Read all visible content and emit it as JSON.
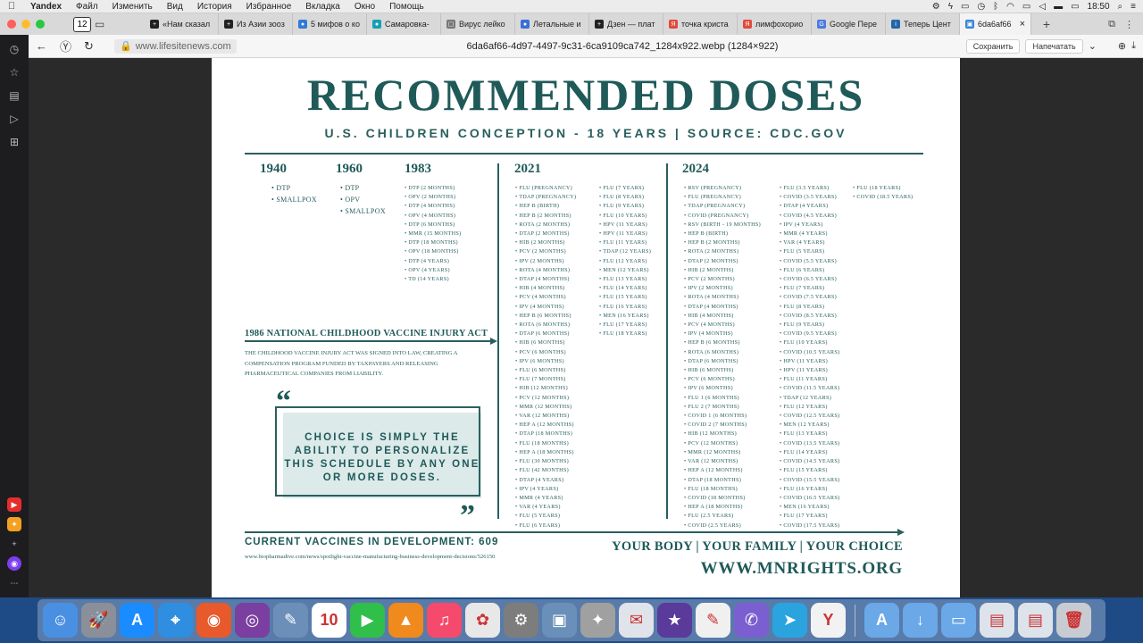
{
  "menubar": {
    "apple": "",
    "items": [
      "Yandex",
      "Файл",
      "Изменить",
      "Вид",
      "История",
      "Избранное",
      "Вкладка",
      "Окно",
      "Помощь"
    ],
    "time": "18:50"
  },
  "tabbar": {
    "tab_count": "12",
    "tabs": [
      {
        "label": "«Нам сказал",
        "color": "#222222",
        "icon": "+"
      },
      {
        "label": "Из Азии зооз",
        "color": "#222222",
        "icon": "+"
      },
      {
        "label": "5 мифов о ко",
        "color": "#2e7bd6",
        "icon": "●"
      },
      {
        "label": "Самаровка-",
        "color": "#16a0b5",
        "icon": "●"
      },
      {
        "label": "Вирус лейко",
        "color": "#777777",
        "icon": "▢"
      },
      {
        "label": "Летальные и",
        "color": "#3b6fd8",
        "icon": "●"
      },
      {
        "label": "Дзен — плат",
        "color": "#222222",
        "icon": "+"
      },
      {
        "label": "точка криста",
        "color": "#e04a3a",
        "icon": "Я"
      },
      {
        "label": "лимфохорио",
        "color": "#e04a3a",
        "icon": "Я"
      },
      {
        "label": "Google Пере",
        "color": "#4a7be0",
        "icon": "G"
      },
      {
        "label": "Теперь Цент",
        "color": "#2266aa",
        "icon": "i"
      },
      {
        "label": "6da6af66",
        "color": "#3a86d6",
        "icon": "▣"
      }
    ]
  },
  "addressbar": {
    "url": "www.lifesitenews.com",
    "page_title": "6da6af66-4d97-4497-9c31-6ca9109ca742_1284x922.webp (1284×922)",
    "save_label": "Сохранить",
    "print_label": "Напечатать"
  },
  "poster": {
    "title": "RECOMMENDED DOSES",
    "subtitle": "U.S. CHILDREN CONCEPTION - 18 YEARS | SOURCE: CDC.GOV",
    "years": [
      "1940",
      "1960",
      "1983",
      "2021",
      "2024"
    ],
    "col_1940": [
      "DTP",
      "SMALLPOX"
    ],
    "col_1960": [
      "DTP",
      "OPV",
      "SMALLPOX"
    ],
    "col_1983": [
      "DTP (2 MONTHS)",
      "OPV (2 MONTHS)",
      "DTP (4 MONTHS)",
      "OPV (4 MONTHS)",
      "DTP (6 MONTHS)",
      "MMR (15 MONTHS)",
      "DTP (18 MONTHS)",
      "OPV (18 MONTHS)",
      "DTP (4 YEARS)",
      "OPV (4 YEARS)",
      "TD (14 YEARS)"
    ],
    "col_2021a": [
      "FLU (PREGNANCY)",
      "TDAP (PREGNANCY)",
      "HEP B (BIRTH)",
      "HEP B (2 MONTHS)",
      "ROTA (2 MONTHS)",
      "DTAP (2 MONTHS)",
      "HIB (2 MONTHS)",
      "PCV (2 MONTHS)",
      "IPV (2 MONTHS)",
      "ROTA (4 MONTHS)",
      "DTAP (4 MONTHS)",
      "HIB (4 MONTHS)",
      "PCV (4 MONTHS)",
      "IPV (4 MONTHS)",
      "HEP B (6 MONTHS)",
      "ROTA (6 MONTHS)",
      "DTAP (6 MONTHS)",
      "HIB (6 MONTHS)",
      "PCV (6 MONTHS)",
      "IPV (6 MONTHS)",
      "FLU (6 MONTHS)",
      "FLU (7 MONTHS)",
      "HIB (12 MONTHS)",
      "PCV (12 MONTHS)",
      "MMR (12 MONTHS)",
      "VAR (12 MONTHS)",
      "HEP A (12 MONTHS)",
      "DTAP (18 MONTHS)",
      "FLU (18 MONTHS)",
      "HEP A (18 MONTHS)",
      "FLU (30 MONTHS)",
      "FLU (42 MONTHS)",
      "DTAP (4 YEARS)",
      "IPV (4 YEARS)",
      "MMR (4 YEARS)",
      "VAR (4 YEARS)",
      "FLU (5 YEARS)",
      "FLU (6 YEARS)"
    ],
    "col_2021b": [
      "FLU (7 YEARS)",
      "FLU (8 YEARS)",
      "FLU (9 YEARS)",
      "FLU (10 YEARS)",
      "HPV (11 YEARS)",
      "HPV (11 YEARS)",
      "FLU (11 YEARS)",
      "TDAP (12 YEARS)",
      "FLU (12 YEARS)",
      "MEN (12 YEARS)",
      "FLU (13 YEARS)",
      "FLU (14 YEARS)",
      "FLU (15 YEARS)",
      "FLU (16 YEARS)",
      "MEN (16 YEARS)",
      "FLU (17 YEARS)",
      "FLU (18 YEARS)"
    ],
    "col_2024a": [
      "RSV (PREGNANCY)",
      "FLU (PREGNANCY)",
      "TDAP (PREGNANCY)",
      "COVID (PREGNANCY)",
      "RSV (BIRTH - 19 MONTHS)",
      "HEP B (BIRTH)",
      "HEP B (2 MONTHS)",
      "ROTA (2 MONTHS)",
      "DTAP (2 MONTHS)",
      "HIB (2 MONTHS)",
      "PCV (2 MONTHS)",
      "IPV (2 MONTHS)",
      "ROTA (4 MONTHS)",
      "DTAP (4 MONTHS)",
      "HIB (4 MONTHS)",
      "PCV (4 MONTHS)",
      "IPV (4 MONTHS)",
      "HEP B (6 MONTHS)",
      "ROTA (6 MONTHS)",
      "DTAP (6 MONTHS)",
      "HIB (6 MONTHS)",
      "PCV (6 MONTHS)",
      "IPV (6 MONTHS)",
      "FLU 1 (6 MONTHS)",
      "FLU 2 (7 MONTHS)",
      "COVID 1 (6 MONTHS)",
      "COVID 2 (7 MONTHS)",
      "HIB (12 MONTHS)",
      "PCV (12 MONTHS)",
      "MMR (12 MONTHS)",
      "VAR (12 MONTHS)",
      "HEP A (12 MONTHS)",
      "DTAP (18 MONTHS)",
      "FLU (18 MONTHS)",
      "COVID (18 MONTHS)",
      "HEP A (18 MONTHS)",
      "FLU (2.5 YEARS)",
      "COVID (2.5 YEARS)"
    ],
    "col_2024b": [
      "FLU (3.5 YEARS)",
      "COVID (3.5 YEARS)",
      "DTAP (4 YEARS)",
      "COVID (4.5 YEARS)",
      "IPV (4 YEARS)",
      "MMR (4 YEARS)",
      "VAR (4 YEARS)",
      "FLU (5 YEARS)",
      "COVID (5.5 YEARS)",
      "FLU (6 YEARS)",
      "COVID (6.5 YEARS)",
      "FLU (7 YEARS)",
      "COVID (7.5 YEARS)",
      "FLU (8 YEARS)",
      "COVID (8.5 YEARS)",
      "FLU (9 YEARS)",
      "COVID (9.5 YEARS)",
      "FLU (10 YEARS)",
      "COVID (10.5 YEARS)",
      "HPV (11 YEARS)",
      "HPV (11 YEARS)",
      "FLU (11 YEARS)",
      "COVID (11.5 YEARS)",
      "TDAP (12 YEARS)",
      "FLU (12 YEARS)",
      "COVID (12.5 YEARS)",
      "MEN (12 YEARS)",
      "FLU (13 YEARS)",
      "COVID (13.5 YEARS)",
      "FLU (14 YEARS)",
      "COVID (14.5 YEARS)",
      "FLU (15 YEARS)",
      "COVID (15.5 YEARS)",
      "FLU (16 YEARS)",
      "COVID (16.5 YEARS)",
      "MEN (16 YEARS)",
      "FLU (17 YEARS)",
      "COVID (17.5 YEARS)"
    ],
    "col_2024c": [
      "FLU (18 YEARS)",
      "COVID (18.5 YEARS)"
    ],
    "act_title": "1986 NATIONAL CHILDHOOD VACCINE INJURY ACT",
    "act_text": "THE CHILDHOOD VACCINE INJURY ACT WAS SIGNED INTO LAW, CREATING A COMPENSATION PROGRAM FUNDED BY TAXPAYERS AND RELEASING PHARMACEUTICAL COMPANIES FROM LIABILITY.",
    "quote_open": "“",
    "quote": "CHOICE IS SIMPLY THE ABILITY TO PERSONALIZE THIS SCHEDULE BY ANY ONE OR MORE DOSES.",
    "quote_close": "”",
    "dev_title": "CURRENT VACCINES IN DEVELOPMENT: 609",
    "dev_link": "www.biopharmadive.com/news/spotlight-vaccine-manufacturing-business-development-decisions/526150",
    "tagline": "YOUR BODY | YOUR FAMILY | YOUR CHOICE",
    "site": "WWW.MNRIGHTS.ORG"
  },
  "dock": {
    "apps": [
      {
        "name": "finder",
        "color": "#4a90e2",
        "glyph": "☺"
      },
      {
        "name": "launchpad",
        "color": "#8a8f99",
        "glyph": "🚀"
      },
      {
        "name": "app-store",
        "color": "#1a8cff",
        "glyph": "A"
      },
      {
        "name": "safari",
        "color": "#2f8ee0",
        "glyph": "⌖"
      },
      {
        "name": "firefox",
        "color": "#e8592b",
        "glyph": "◉"
      },
      {
        "name": "tor",
        "color": "#7a3fa0",
        "glyph": "◎"
      },
      {
        "name": "preview",
        "color": "#6b8fb8",
        "glyph": "✎"
      },
      {
        "name": "calendar",
        "color": "#ffffff",
        "glyph": "10"
      },
      {
        "name": "facetime",
        "color": "#2fbf4a",
        "glyph": "▶"
      },
      {
        "name": "vlc",
        "color": "#f08a1c",
        "glyph": "▲"
      },
      {
        "name": "music",
        "color": "#f64a6c",
        "glyph": "♫"
      },
      {
        "name": "photos",
        "color": "#e8e8e8",
        "glyph": "✿"
      },
      {
        "name": "system-preferences",
        "color": "#7d7d7d",
        "glyph": "⚙"
      },
      {
        "name": "image-capture",
        "color": "#6a8fb8",
        "glyph": "▣"
      },
      {
        "name": "scripts",
        "color": "#a0a0a0",
        "glyph": "✦"
      },
      {
        "name": "mail",
        "color": "#e0e4ea",
        "glyph": "✉"
      },
      {
        "name": "imovie",
        "color": "#5a3a9a",
        "glyph": "★"
      },
      {
        "name": "notes",
        "color": "#f0f0f0",
        "glyph": "✎"
      },
      {
        "name": "viber",
        "color": "#7b5fd0",
        "glyph": "✆"
      },
      {
        "name": "telegram",
        "color": "#2aa3df",
        "glyph": "➤"
      },
      {
        "name": "yandex-browser",
        "color": "#f2f2f2",
        "glyph": "Y"
      }
    ],
    "stacks": [
      {
        "name": "applications-folder",
        "color": "#6aa8e8",
        "glyph": "A"
      },
      {
        "name": "downloads-folder",
        "color": "#6aa8e8",
        "glyph": "↓"
      },
      {
        "name": "documents-folder",
        "color": "#6aa8e8",
        "glyph": "▭"
      },
      {
        "name": "screenshot-1",
        "color": "#dde3ea",
        "glyph": "▤"
      },
      {
        "name": "screenshot-2",
        "color": "#dde3ea",
        "glyph": "▤"
      },
      {
        "name": "trash",
        "color": "#c8ccd2",
        "glyph": "🗑"
      }
    ]
  }
}
